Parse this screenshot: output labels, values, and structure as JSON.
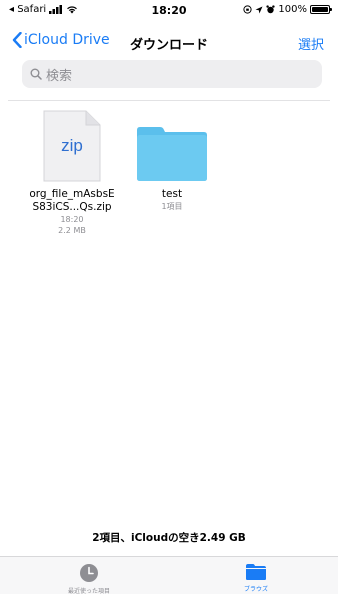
{
  "status_bar": {
    "carrier": "◂ Safari",
    "time": "18:20",
    "battery": "100%"
  },
  "nav": {
    "back_label": "iCloud Drive",
    "title": "ダウンロード",
    "select_label": "選択"
  },
  "search": {
    "placeholder": "検索"
  },
  "files": [
    {
      "type": "zip",
      "icon_text": "zip",
      "name_line1": "org_file_mAsbsE",
      "name_line2": "S83iCS...Qs.zip",
      "time": "18:20",
      "size": "2.2 MB"
    },
    {
      "type": "folder",
      "name": "test",
      "count": "1項目"
    }
  ],
  "summary": "2項目、iCloudの空き2.49 GB",
  "tab_bar": {
    "recent_label": "最近使った項目",
    "browse_label": "ブラウズ"
  },
  "colors": {
    "accent": "#1a7cf5",
    "folder": "#62c3ee",
    "secondary_text": "#8e8e93"
  }
}
